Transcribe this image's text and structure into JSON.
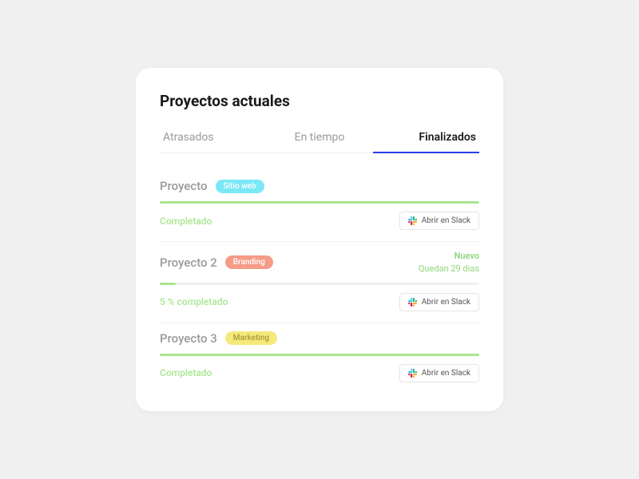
{
  "title": "Proyectos actuales",
  "tabs": [
    {
      "label": "Atrasados",
      "active": false
    },
    {
      "label": "En tiempo",
      "active": false
    },
    {
      "label": "Finalizados",
      "active": true
    }
  ],
  "slack_button_label": "Abrir en Slack",
  "projects": [
    {
      "name": "Proyecto",
      "tag": "Sitio web",
      "tag_class": "web",
      "progress": 100,
      "status": "Completado",
      "side_new": "",
      "side_days": ""
    },
    {
      "name": "Proyecto 2",
      "tag": "Branding",
      "tag_class": "branding",
      "progress": 5,
      "status": "5 % completado",
      "side_new": "Nuevo",
      "side_days": "Quedan 29 días"
    },
    {
      "name": "Proyecto 3",
      "tag": "Marketing",
      "tag_class": "marketing",
      "progress": 100,
      "status": "Completado",
      "side_new": "",
      "side_days": ""
    }
  ]
}
